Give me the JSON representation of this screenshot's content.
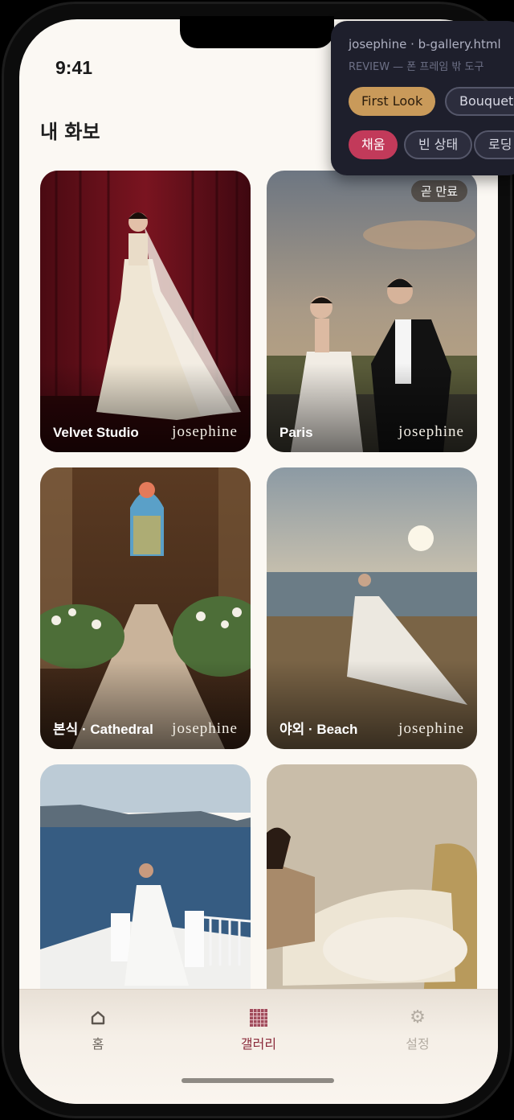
{
  "status": {
    "time": "9:41"
  },
  "page": {
    "title": "내 화보"
  },
  "gallery": {
    "brand": "josephine",
    "cards": [
      {
        "title": "Velvet Studio",
        "brand": "josephine"
      },
      {
        "title": "Paris",
        "brand": "josephine",
        "badge": "곧 만료"
      },
      {
        "title": "본식 · Cathedral",
        "brand": "josephine"
      },
      {
        "title": "야외 · Beach",
        "brand": "josephine"
      },
      {
        "title": "",
        "brand": ""
      },
      {
        "title": "",
        "brand": ""
      }
    ]
  },
  "tabbar": {
    "items": [
      {
        "label": "홈",
        "icon": "home-icon"
      },
      {
        "label": "갤러리",
        "icon": "grid-icon"
      },
      {
        "label": "설정",
        "icon": "gear-icon"
      }
    ],
    "active_color": "#8a2a3a"
  },
  "review_panel": {
    "title": "josephine · b-gallery.html",
    "subtitle": "REVIEW — 폰 프레임 밖 도구",
    "chips_row1": [
      "First Look",
      "Bouquet"
    ],
    "chips_row2": [
      "채움",
      "빈 상태",
      "로딩"
    ]
  }
}
